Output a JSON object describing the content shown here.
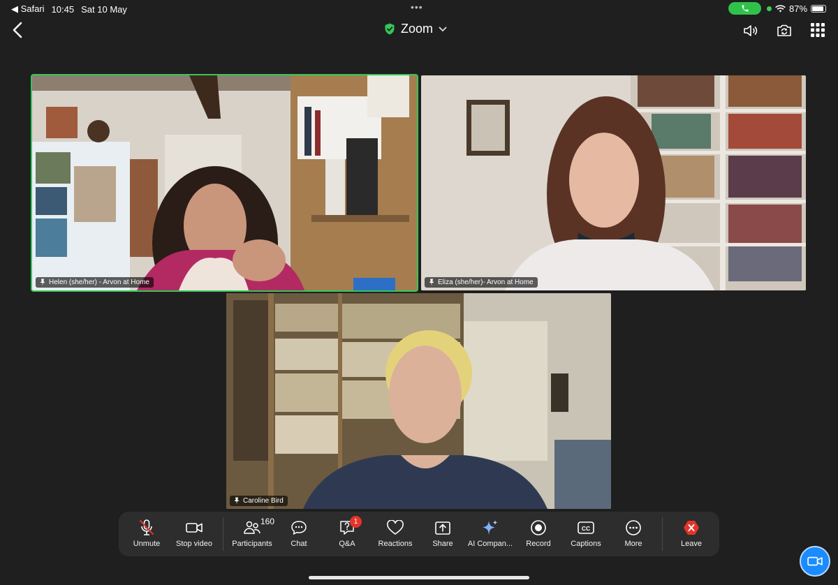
{
  "status_bar": {
    "back_app": "◀ Safari",
    "time": "10:45",
    "date": "Sat 10 May",
    "dots": "•••",
    "battery": "87%",
    "battery_level": 0.87
  },
  "header": {
    "title": "Zoom",
    "icons": [
      "chevron-left-icon",
      "shield-check-icon",
      "chevron-down-icon",
      "speaker-icon",
      "camera-switch-icon",
      "grid-icon"
    ]
  },
  "tiles": [
    {
      "name": "Helen (she/her) - Arvon at Home",
      "active": true
    },
    {
      "name": "Eliza (she/her)- Arvon at Home",
      "active": false
    },
    {
      "name": "Caroline Bird",
      "active": false
    }
  ],
  "toolbar": {
    "unmute": "Unmute",
    "stop_video": "Stop video",
    "participants": "Participants",
    "participants_count": "160",
    "chat": "Chat",
    "qa": "Q&A",
    "qa_badge": "1",
    "reactions": "Reactions",
    "share": "Share",
    "ai_companion": "AI Compan...",
    "record": "Record",
    "captions": "Captions",
    "captions_icon": "CC",
    "more": "More",
    "leave": "Leave"
  },
  "colors": {
    "background": "#1f1f1f",
    "active_border": "#34c759",
    "accent_blue": "#1a8cff",
    "leave_red": "#e5342b"
  }
}
